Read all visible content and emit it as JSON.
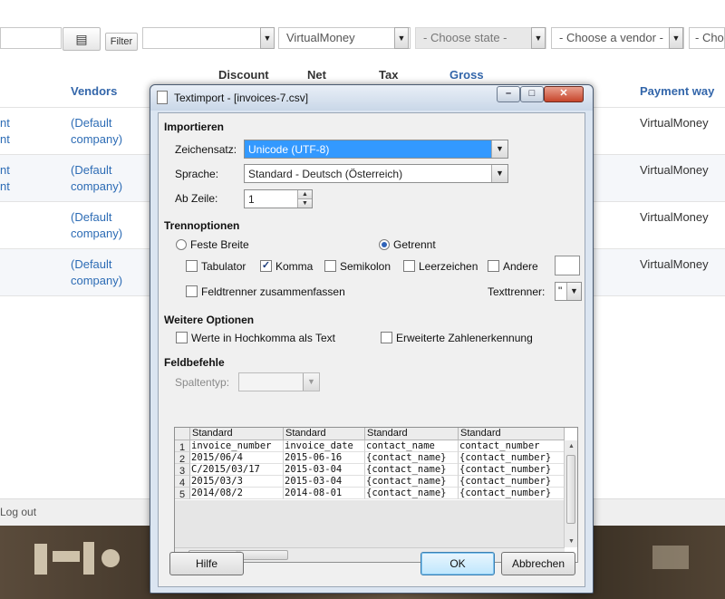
{
  "background": {
    "filters": {
      "filter_button": "Filter",
      "currency_value": "VirtualMoney",
      "state_placeholder": "- Choose state -",
      "vendor_placeholder": "- Choose a vendor -",
      "cut_placeholder": "- Cho"
    },
    "columns": {
      "vendors": "Vendors",
      "discount": "Discount",
      "net": "Net",
      "tax": "Tax",
      "gross": "Gross",
      "payment_way": "Payment way"
    },
    "rows": [
      {
        "left_line1": "nt",
        "left_line2": "nt",
        "vendor_line1": "(Default",
        "vendor_line2": "company)",
        "payment": "VirtualMoney"
      },
      {
        "left_line1": "nt",
        "left_line2": "nt",
        "vendor_line1": "(Default",
        "vendor_line2": "company)",
        "payment": "VirtualMoney"
      },
      {
        "left_line1": "",
        "left_line2": "",
        "vendor_line1": "(Default",
        "vendor_line2": "company)",
        "payment": "VirtualMoney"
      },
      {
        "left_line1": "",
        "left_line2": "",
        "vendor_line1": "(Default",
        "vendor_line2": "company)",
        "payment": "VirtualMoney"
      }
    ],
    "footer": {
      "logout": "Log out"
    }
  },
  "dialog": {
    "title": "Textimport - [invoices-7.csv]",
    "window_buttons": {
      "minimize": "–",
      "maximize": "□",
      "close": "✕"
    },
    "import": {
      "heading": "Importieren",
      "charset_label": "Zeichensatz:",
      "charset_value": "Unicode (UTF-8)",
      "language_label": "Sprache:",
      "language_value": "Standard - Deutsch (Österreich)",
      "from_row_label": "Ab Zeile:",
      "from_row_value": "1"
    },
    "separator": {
      "heading": "Trennoptionen",
      "fixed_width": "Feste Breite",
      "separated": "Getrennt",
      "tab": "Tabulator",
      "comma": "Komma",
      "semicolon": "Semikolon",
      "space": "Leerzeichen",
      "other": "Andere",
      "merge": "Feldtrenner zusammenfassen",
      "text_delimiter_label": "Texttrenner:",
      "text_delimiter_value": "\""
    },
    "more": {
      "heading": "Weitere Optionen",
      "quoted_as_text": "Werte in Hochkomma als Text",
      "detect_special_numbers": "Erweiterte Zahlenerkennung"
    },
    "fields": {
      "heading": "Feldbefehle",
      "column_type_label": "Spaltentyp:",
      "column_type_value": ""
    },
    "preview": {
      "headers": [
        "Standard",
        "Standard",
        "Standard",
        "Standard"
      ],
      "row_numbers": [
        "1",
        "2",
        "3",
        "4",
        "5"
      ],
      "rows": [
        [
          "invoice_number",
          "invoice_date",
          "contact_name",
          "contact_number"
        ],
        [
          "2015/06/4",
          "2015-06-16",
          "{contact_name}",
          "{contact_number}"
        ],
        [
          "C/2015/03/17",
          "2015-03-04",
          "{contact_name}",
          "{contact_number}"
        ],
        [
          "2015/03/3",
          "2015-03-04",
          "{contact_name}",
          "{contact_number}"
        ],
        [
          "2014/08/2",
          "2014-08-01",
          "{contact_name}",
          "{contact_number}"
        ]
      ]
    },
    "buttons": {
      "help": "Hilfe",
      "ok": "OK",
      "cancel": "Abbrechen"
    }
  }
}
